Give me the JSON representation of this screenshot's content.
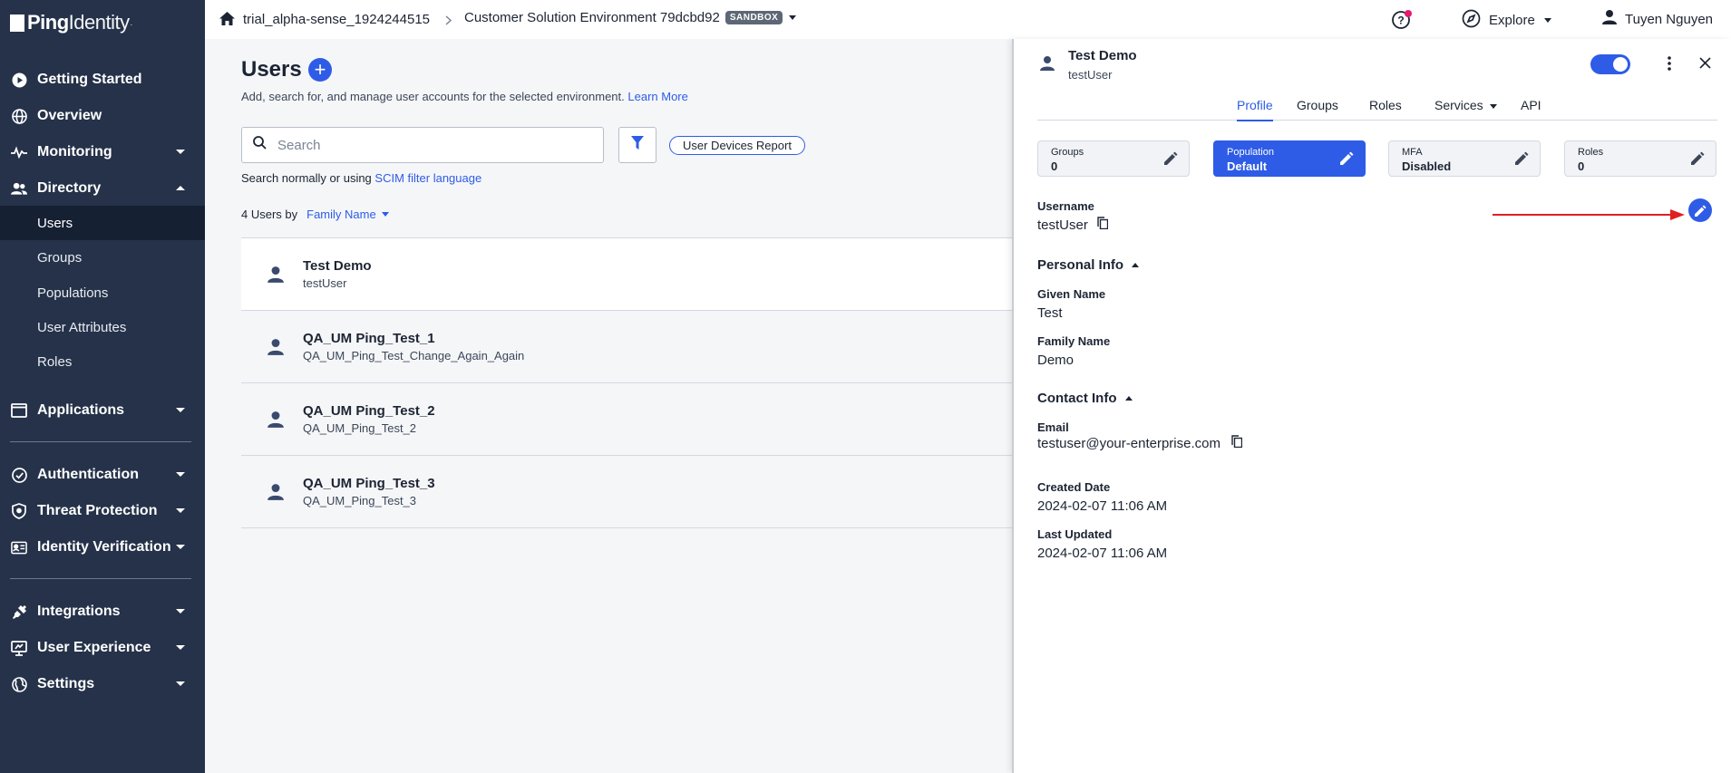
{
  "brand": {
    "name_bold": "Ping",
    "name_light": "Identity",
    "mark": "."
  },
  "sidebar": {
    "items": [
      {
        "label": "Getting Started",
        "icon": "play-circle-icon"
      },
      {
        "label": "Overview",
        "icon": "globe-icon"
      },
      {
        "label": "Monitoring",
        "icon": "pulse-icon"
      },
      {
        "label": "Directory",
        "icon": "users-icon"
      },
      {
        "label": "Applications",
        "icon": "window-icon"
      },
      {
        "label": "Authentication",
        "icon": "check-circle-icon"
      },
      {
        "label": "Threat Protection",
        "icon": "shield-icon"
      },
      {
        "label": "Identity Verification",
        "icon": "id-card-icon"
      },
      {
        "label": "Integrations",
        "icon": "plug-icon"
      },
      {
        "label": "User Experience",
        "icon": "monitor-icon"
      },
      {
        "label": "Settings",
        "icon": "globe-settings-icon"
      }
    ],
    "directory_sub": [
      "Users",
      "Groups",
      "Populations",
      "User Attributes",
      "Roles"
    ]
  },
  "topbar": {
    "org": "trial_alpha-sense_1924244515",
    "environment": "Customer Solution Environment 79dcbd92",
    "env_badge": "SANDBOX",
    "explore": "Explore",
    "user": "Tuyen Nguyen"
  },
  "main": {
    "title": "Users",
    "subtitle": "Add, search for, and manage user accounts for the selected environment.",
    "learn_more": "Learn More",
    "search_placeholder": "Search",
    "report_button": "User Devices Report",
    "hint_prefix": "Search normally or using",
    "hint_link": "SCIM filter language",
    "count_text": "4 Users by",
    "sort_field": "Family Name",
    "users": [
      {
        "name": "Test Demo",
        "login": "testUser"
      },
      {
        "name": "QA_UM Ping_Test_1",
        "login": "QA_UM_Ping_Test_Change_Again_Again"
      },
      {
        "name": "QA_UM Ping_Test_2",
        "login": "QA_UM_Ping_Test_2"
      },
      {
        "name": "QA_UM Ping_Test_3",
        "login": "QA_UM_Ping_Test_3"
      }
    ]
  },
  "panel": {
    "name": "Test Demo",
    "login": "testUser",
    "tabs": [
      "Profile",
      "Groups",
      "Roles",
      "Services",
      "API"
    ],
    "cards": [
      {
        "label": "Groups",
        "value": "0"
      },
      {
        "label": "Population",
        "value": "Default"
      },
      {
        "label": "MFA",
        "value": "Disabled"
      },
      {
        "label": "Roles",
        "value": "0"
      }
    ],
    "username_label": "Username",
    "username": "testUser",
    "personal_info": "Personal Info",
    "given_name_label": "Given Name",
    "given_name": "Test",
    "family_name_label": "Family Name",
    "family_name": "Demo",
    "contact_info": "Contact Info",
    "email_label": "Email",
    "email": "testuser@your-enterprise.com",
    "created_label": "Created Date",
    "created": "2024-02-07 11:06 AM",
    "updated_label": "Last Updated",
    "updated": "2024-02-07 11:06 AM"
  },
  "colors": {
    "accent": "#2e5ce6",
    "sidebar": "#253249",
    "arrow": "#e02020"
  }
}
